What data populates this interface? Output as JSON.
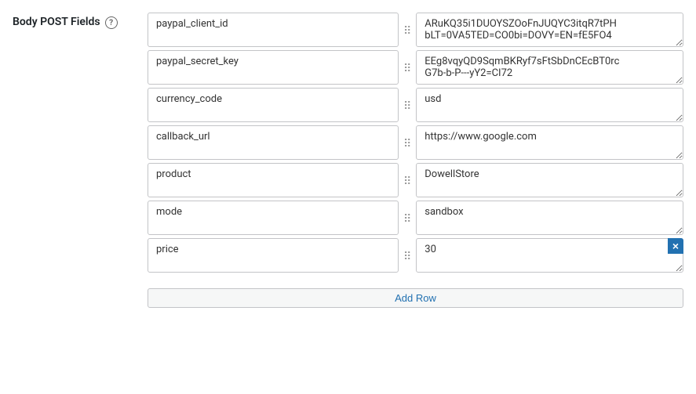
{
  "header": {
    "title": "Body POST Fields",
    "help_tooltip": "Help"
  },
  "fields": [
    {
      "id": "field-1",
      "key": "paypal_client_id",
      "value": "ARuKQ35i1DUOYSZOoFnJUQYC3itqR7tPH\nbLT=0VA5TED=CO0bi=DOVY=EN=fE5FO4"
    },
    {
      "id": "field-2",
      "key": "paypal_secret_key",
      "value": "EEg8vqyQD9SqmBKRyf7sFtSbDnCEcBT0rc\nG7b-b-P---yY2=CI72"
    },
    {
      "id": "field-3",
      "key": "currency_code",
      "value": "usd"
    },
    {
      "id": "field-4",
      "key": "callback_url",
      "value": "https://www.google.com"
    },
    {
      "id": "field-5",
      "key": "product",
      "value": "DowellStore"
    },
    {
      "id": "field-6",
      "key": "mode",
      "value": "sandbox"
    },
    {
      "id": "field-7",
      "key": "price",
      "value": "30",
      "is_last": true
    }
  ],
  "buttons": {
    "add_row": "Add Row",
    "delete": "×",
    "drag_handle": "⠿"
  }
}
